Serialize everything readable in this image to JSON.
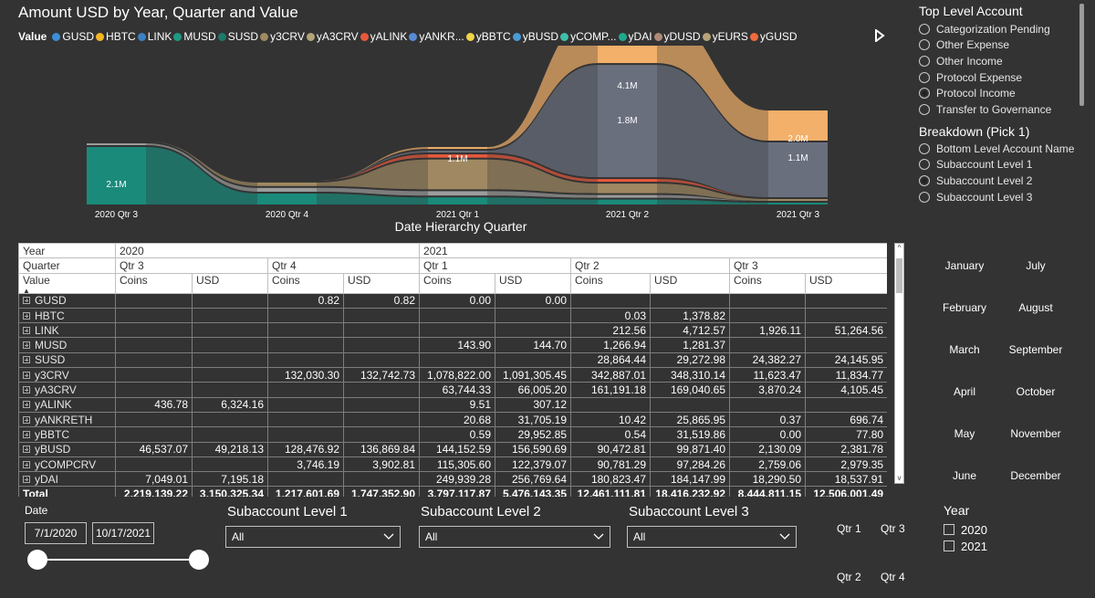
{
  "chart": {
    "title": "Amount USD by Year, Quarter and Value",
    "x_axis_title": "Date Hierarchy Quarter",
    "legend_title": "Value",
    "legend": [
      {
        "label": "GUSD",
        "color": "#3b8fd9"
      },
      {
        "label": "HBTC",
        "color": "#f2b623"
      },
      {
        "label": "LINK",
        "color": "#3b82c4"
      },
      {
        "label": "MUSD",
        "color": "#1e9a84"
      },
      {
        "label": "SUSD",
        "color": "#1c7a6a"
      },
      {
        "label": "y3CRV",
        "color": "#a08962"
      },
      {
        "label": "yA3CRV",
        "color": "#b3a57a"
      },
      {
        "label": "yALINK",
        "color": "#e8593c"
      },
      {
        "label": "yANKR...",
        "color": "#5a8ad6"
      },
      {
        "label": "yBBTC",
        "color": "#f0d548"
      },
      {
        "label": "yBUSD",
        "color": "#4a9ad8"
      },
      {
        "label": "yCOMP...",
        "color": "#3fbfa8"
      },
      {
        "label": "yDAI",
        "color": "#1fa98e"
      },
      {
        "label": "yDUSD",
        "color": "#b08a78"
      },
      {
        "label": "yEURS",
        "color": "#b8a27a"
      },
      {
        "label": "yGUSD",
        "color": "#f06a3c"
      }
    ],
    "legend_next_icon": "play-icon"
  },
  "chart_data": {
    "type": "area",
    "subtype": "ribbon",
    "title": "Amount USD by Year, Quarter and Value",
    "xlabel": "Date Hierarchy Quarter",
    "categories": [
      "2020 Qtr 3",
      "2020 Qtr 4",
      "2021 Qtr 1",
      "2021 Qtr 2",
      "2021 Qtr 3"
    ],
    "data_labels": [
      {
        "category": "2020 Qtr 3",
        "text": "2.1M"
      },
      {
        "category": "2021 Qtr 1",
        "text": "1.1M"
      },
      {
        "category": "2021 Qtr 2",
        "text": "4.1M"
      },
      {
        "category": "2021 Qtr 2",
        "text": "1.8M"
      },
      {
        "category": "2021 Qtr 3",
        "text": "2.0M"
      },
      {
        "category": "2021 Qtr 3",
        "text": "1.1M"
      }
    ],
    "totals_usd": [
      3150325.34,
      1747352.9,
      5476143.35,
      18416232.92,
      12506001.49
    ],
    "series": [
      {
        "name": "yDAI",
        "color": "#1a8a7a",
        "values": [
          2.1,
          0.4,
          0.26,
          0.18,
          0.02
        ]
      },
      {
        "name": "yBUSD",
        "color": "#9c9c9c",
        "values": [
          0.05,
          0.14,
          0.16,
          0.1,
          0.0
        ]
      },
      {
        "name": "y3CRV",
        "color": "#a08962",
        "values": [
          0,
          0.13,
          1.09,
          0.35,
          0.01
        ]
      },
      {
        "name": "yCOMPCRV",
        "color": "#e8593c",
        "values": [
          0,
          0,
          0.12,
          0.1,
          0.0
        ]
      },
      {
        "name": "GUSD",
        "color": "#6a6f7e",
        "values": [
          0,
          0,
          0.05,
          4.1,
          2.0
        ]
      },
      {
        "name": "HBTC",
        "color": "#f2b06a",
        "values": [
          0,
          0,
          0.05,
          1.8,
          1.1
        ]
      }
    ]
  },
  "slicers": {
    "top_level": {
      "title": "Top Level Account",
      "options": [
        {
          "label": "Categorization Pending",
          "selected": false
        },
        {
          "label": "Other Expense",
          "selected": false
        },
        {
          "label": "Other Income",
          "selected": false
        },
        {
          "label": "Protocol Expense",
          "selected": false
        },
        {
          "label": "Protocol Income",
          "selected": true
        },
        {
          "label": "Transfer to Governance",
          "selected": false
        }
      ]
    },
    "breakdown": {
      "title": "Breakdown (Pick 1)",
      "options": [
        {
          "label": "Bottom Level Account Name",
          "selected": false
        },
        {
          "label": "Subaccount Level 1",
          "selected": false
        },
        {
          "label": "Subaccount Level 2",
          "selected": true
        },
        {
          "label": "Subaccount Level 3",
          "selected": false
        }
      ]
    },
    "months": [
      "January",
      "July",
      "February",
      "August",
      "March",
      "September",
      "April",
      "October",
      "May",
      "November",
      "June",
      "December"
    ],
    "date": {
      "label": "Date",
      "start": "7/1/2020",
      "end": "10/17/2021"
    },
    "sub1": {
      "label": "Subaccount Level 1",
      "value": "All"
    },
    "sub2": {
      "label": "Subaccount Level 2",
      "value": "All"
    },
    "sub3": {
      "label": "Subaccount Level 3",
      "value": "All"
    },
    "quarters": [
      "Qtr 1",
      "Qtr 3",
      "Qtr 2",
      "Qtr 4"
    ],
    "year": {
      "title": "Year",
      "options": [
        "2020",
        "2021"
      ]
    }
  },
  "matrix": {
    "header_rows": {
      "year": {
        "label": "Year",
        "y2020": "2020",
        "y2021": "2021"
      },
      "quarter": {
        "label": "Quarter",
        "q3_2020": "Qtr 3",
        "q4_2020": "Qtr 4",
        "q1_2021": "Qtr 1",
        "q2_2021": "Qtr 2",
        "q3_2021": "Qtr 3"
      },
      "value": {
        "label": "Value",
        "coins": "Coins",
        "usd": "USD"
      }
    },
    "rows": [
      {
        "label": "GUSD",
        "cells": [
          "",
          "",
          "0.82",
          "0.82",
          "0.00",
          "0.00",
          "",
          "",
          "",
          ""
        ]
      },
      {
        "label": "HBTC",
        "cells": [
          "",
          "",
          "",
          "",
          "",
          "",
          "0.03",
          "1,378.82",
          "",
          ""
        ]
      },
      {
        "label": "LINK",
        "cells": [
          "",
          "",
          "",
          "",
          "",
          "",
          "212.56",
          "4,712.57",
          "1,926.11",
          "51,264.56"
        ]
      },
      {
        "label": "MUSD",
        "cells": [
          "",
          "",
          "",
          "",
          "143.90",
          "144.70",
          "1,266.94",
          "1,281.37",
          "",
          ""
        ]
      },
      {
        "label": "SUSD",
        "cells": [
          "",
          "",
          "",
          "",
          "",
          "",
          "28,864.44",
          "29,272.98",
          "24,382.27",
          "24,145.95"
        ]
      },
      {
        "label": "y3CRV",
        "cells": [
          "",
          "",
          "132,030.30",
          "132,742.73",
          "1,078,822.00",
          "1,091,305.45",
          "342,887.01",
          "348,310.14",
          "11,623.47",
          "11,834.77"
        ]
      },
      {
        "label": "yA3CRV",
        "cells": [
          "",
          "",
          "",
          "",
          "63,744.33",
          "66,005.20",
          "161,191.18",
          "169,040.65",
          "3,870.24",
          "4,105.45"
        ]
      },
      {
        "label": "yALINK",
        "cells": [
          "436.78",
          "6,324.16",
          "",
          "",
          "9.51",
          "307.12",
          "",
          "",
          "",
          ""
        ]
      },
      {
        "label": "yANKRETH",
        "cells": [
          "",
          "",
          "",
          "",
          "20.68",
          "31,705.19",
          "10.42",
          "25,865.95",
          "0.37",
          "696.74"
        ]
      },
      {
        "label": "yBBTC",
        "cells": [
          "",
          "",
          "",
          "",
          "0.59",
          "29,952.85",
          "0.54",
          "31,519.86",
          "0.00",
          "77.80"
        ]
      },
      {
        "label": "yBUSD",
        "cells": [
          "46,537.07",
          "49,218.13",
          "128,476.92",
          "136,869.84",
          "144,152.59",
          "156,590.69",
          "90,472.81",
          "99,871.40",
          "2,130.09",
          "2,381.78"
        ]
      },
      {
        "label": "yCOMPCRV",
        "cells": [
          "",
          "",
          "3,746.19",
          "3,902.81",
          "115,305.60",
          "122,379.07",
          "90,781.29",
          "97,284.26",
          "2,759.06",
          "2,979.35"
        ]
      },
      {
        "label": "yDAI",
        "cells": [
          "7,049.01",
          "7,195.18",
          "",
          "",
          "249,939.28",
          "256,769.64",
          "180,823.47",
          "184,147.99",
          "18,290.50",
          "18,537.91"
        ]
      }
    ],
    "total": {
      "label": "Total",
      "cells": [
        "2,219,139.22",
        "3,150,325.34",
        "1,217,601.69",
        "1,747,352.90",
        "3,797,117.87",
        "5,476,143.35",
        "12,461,111.81",
        "18,416,232.92",
        "8,444,811.15",
        "12,506,001.49"
      ]
    }
  }
}
